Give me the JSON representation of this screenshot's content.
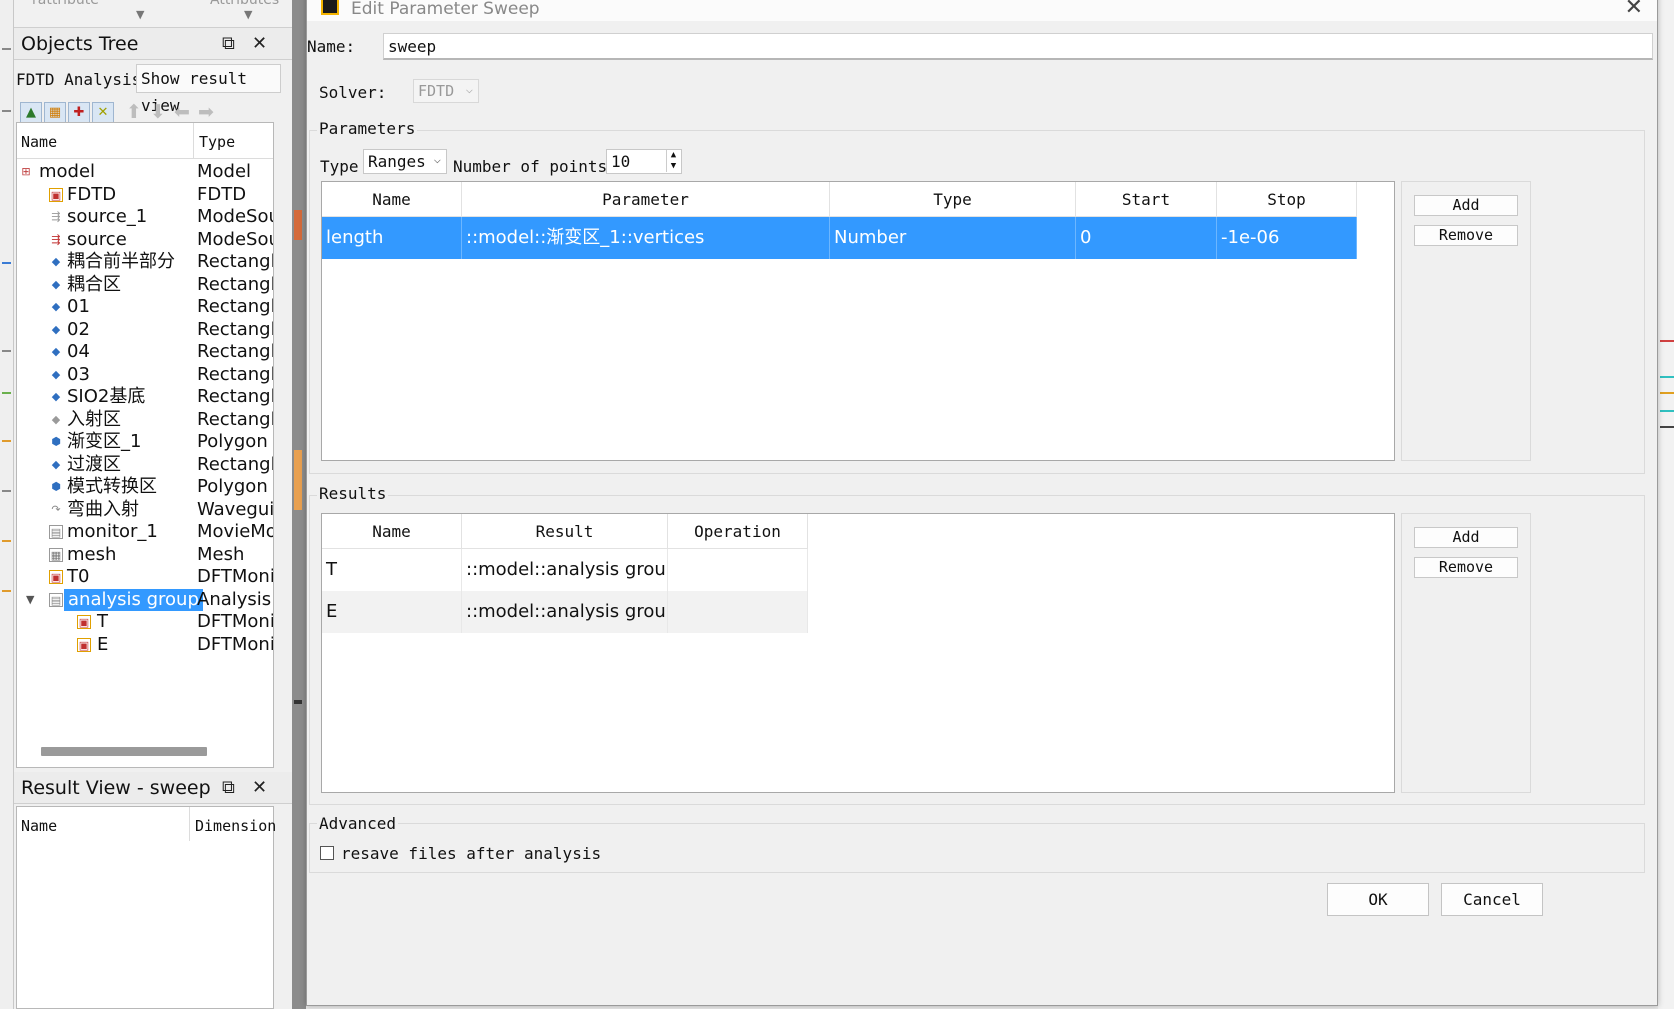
{
  "top_cut": {
    "left": "rattribute",
    "right": "Attributes"
  },
  "objects_tree": {
    "title": "Objects Tree",
    "analysis_label": "FDTD Analysis",
    "show_result_button": "Show result view",
    "columns": {
      "name": "Name",
      "type": "Type"
    },
    "items": [
      {
        "name": "model",
        "type": "Model"
      },
      {
        "name": "FDTD",
        "type": "FDTD"
      },
      {
        "name": "source_1",
        "type": "ModeSou"
      },
      {
        "name": "source",
        "type": "ModeSou"
      },
      {
        "name": "耦合前半部分",
        "type": "Rectangle"
      },
      {
        "name": "耦合区",
        "type": "Rectangle"
      },
      {
        "name": "01",
        "type": "Rectangle"
      },
      {
        "name": "02",
        "type": "Rectangle"
      },
      {
        "name": "04",
        "type": "Rectangle"
      },
      {
        "name": "03",
        "type": "Rectangle"
      },
      {
        "name": "SIO2基底",
        "type": "Rectangle"
      },
      {
        "name": "入射区",
        "type": "Rectangle"
      },
      {
        "name": "渐变区_1",
        "type": "Polygon"
      },
      {
        "name": "过渡区",
        "type": "Rectangle"
      },
      {
        "name": "模式转换区",
        "type": "Polygon"
      },
      {
        "name": "弯曲入射",
        "type": "Waveguid"
      },
      {
        "name": "monitor_1",
        "type": "MovieMo"
      },
      {
        "name": "mesh",
        "type": "Mesh"
      },
      {
        "name": "T0",
        "type": "DFTMonit"
      },
      {
        "name": "analysis group",
        "type": "Analysis G"
      },
      {
        "name": "T",
        "type": "DFTMonit"
      },
      {
        "name": "E",
        "type": "DFTMonit"
      }
    ]
  },
  "result_view": {
    "title": "Result View - sweep",
    "columns": {
      "name": "Name",
      "dimension": "Dimension"
    }
  },
  "dialog": {
    "title": "Edit Parameter Sweep",
    "name_label": "Name:",
    "name_value": "sweep",
    "solver_label": "Solver:",
    "solver_value": "FDTD",
    "parameters": {
      "group_title": "Parameters",
      "type_label": "Type",
      "type_value": "Ranges",
      "points_label": "Number of points:",
      "points_value": "10",
      "columns": [
        "Name",
        "Parameter",
        "Type",
        "Start",
        "Stop"
      ],
      "rows": [
        {
          "name": "length",
          "parameter": "::model::渐变区_1::vertices",
          "type": "Number",
          "start": "0",
          "stop": "-1e-06"
        }
      ],
      "add_label": "Add",
      "remove_label": "Remove"
    },
    "results": {
      "group_title": "Results",
      "columns": [
        "Name",
        "Result",
        "Operation"
      ],
      "rows": [
        {
          "name": "T",
          "result": "::model::analysis group...",
          "operation": ""
        },
        {
          "name": "E",
          "result": "::model::analysis group...",
          "operation": ""
        }
      ],
      "add_label": "Add",
      "remove_label": "Remove"
    },
    "advanced": {
      "group_title": "Advanced",
      "resave_label": "resave files after analysis",
      "resave_checked": false
    },
    "ok_label": "OK",
    "cancel_label": "Cancel"
  },
  "colors": {
    "selection": "#3399ff",
    "dialog_bg": "#f0f0f0"
  }
}
